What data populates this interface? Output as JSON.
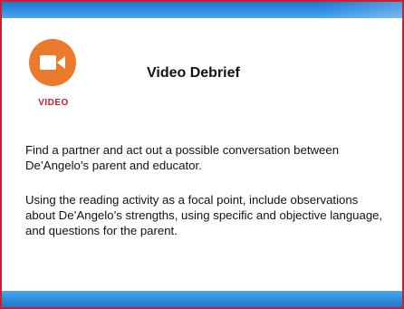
{
  "slide": {
    "title": "Video Debrief",
    "icon": {
      "name": "video-camera-icon",
      "label": "VIDEO",
      "color": "#ec7a2c"
    },
    "paragraphs": [
      "Find a partner and act out a possible conversation between De’Angelo’s parent and educator.",
      "Using the reading activity as a focal point, include observations about De’Angelo’s strengths, using specific and objective language, and questions for the parent."
    ],
    "colors": {
      "frame": "#c8202f",
      "band": "#2f8de0",
      "label": "#c8202f"
    }
  }
}
